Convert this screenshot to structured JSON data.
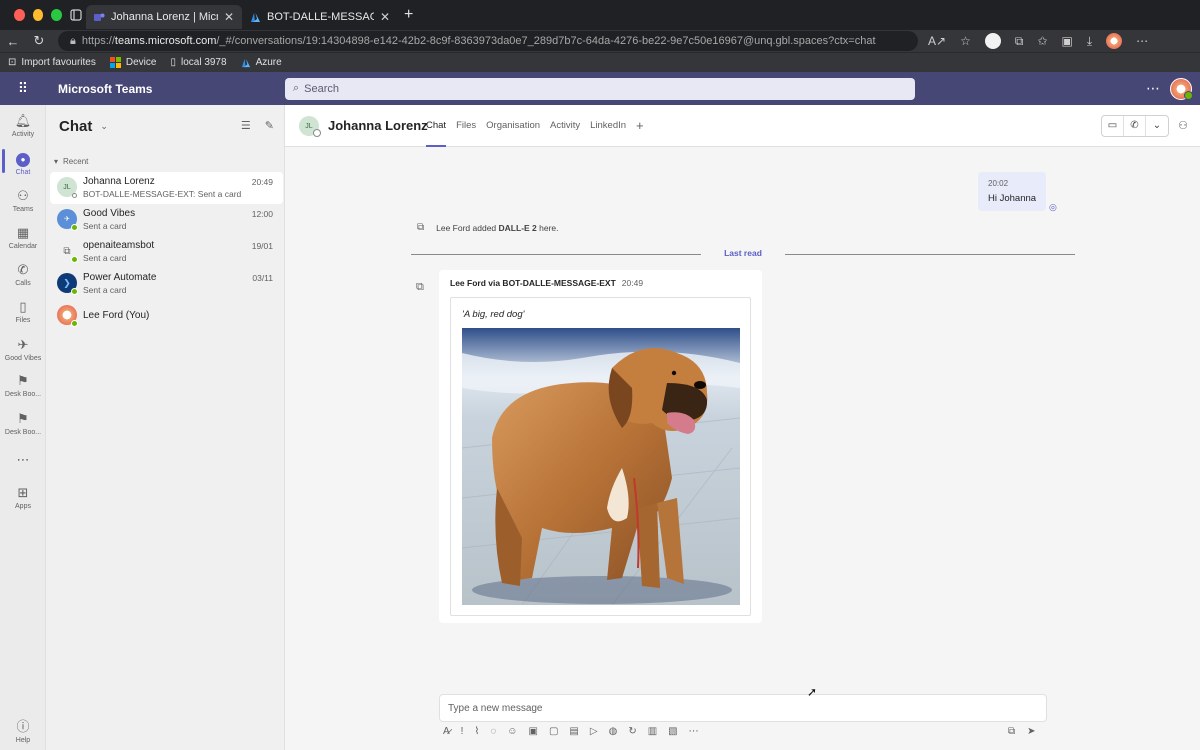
{
  "browser": {
    "tabs": [
      {
        "title": "Johanna Lorenz | Microsoft Teams",
        "active": true
      },
      {
        "title": "BOT-DALLE-MESSAGE-EXT - Mic",
        "active": false
      }
    ],
    "url_prefix": "https://",
    "url_host": "teams.microsoft.com",
    "url_path": "/_#/conversations/19:14304898-e142-42b2-8c9f-8363973da0e7_289d7b7c-64da-4276-be22-9e7c50e16967@unq.gbl.spaces?ctx=chat",
    "bookmarks": [
      "Import favourites",
      "Device",
      "local 3978",
      "Azure"
    ]
  },
  "teams": {
    "app_title": "Microsoft Teams",
    "search_placeholder": "Search",
    "accent": "#5b5fc7",
    "header_bg": "#464775"
  },
  "rail": [
    {
      "label": "Activity",
      "icon": "bell-icon"
    },
    {
      "label": "Chat",
      "icon": "chat-icon",
      "active": true
    },
    {
      "label": "Teams",
      "icon": "teams-icon"
    },
    {
      "label": "Calendar",
      "icon": "calendar-icon"
    },
    {
      "label": "Calls",
      "icon": "phone-icon"
    },
    {
      "label": "Files",
      "icon": "file-icon"
    },
    {
      "label": "Good Vibes",
      "icon": "good-vibes-icon"
    },
    {
      "label": "Desk Boo...",
      "icon": "desk-booking-icon"
    },
    {
      "label": "Desk Boo...",
      "icon": "desk-booking-icon"
    },
    {
      "label": "",
      "icon": "more-icon"
    },
    {
      "label": "Apps",
      "icon": "apps-icon"
    },
    {
      "label": "Help",
      "icon": "help-icon"
    }
  ],
  "chatlist": {
    "heading": "Chat",
    "section": "Recent",
    "items": [
      {
        "name": "Johanna Lorenz",
        "initials": "JL",
        "preview": "BOT-DALLE-MESSAGE-EXT: Sent a card",
        "time": "20:49",
        "selected": true
      },
      {
        "name": "Good Vibes",
        "preview": "Sent a card",
        "time": "12:00"
      },
      {
        "name": "openaiteamsbot",
        "preview": "Sent a card",
        "time": "19/01"
      },
      {
        "name": "Power Automate",
        "preview": "Sent a card",
        "time": "03/11"
      },
      {
        "name": "Lee Ford (You)",
        "preview": "",
        "time": ""
      }
    ]
  },
  "conversation": {
    "name": "Johanna Lorenz",
    "initials": "JL",
    "tabs": [
      "Chat",
      "Files",
      "Organisation",
      "Activity",
      "LinkedIn"
    ],
    "outgoing": {
      "time": "20:02",
      "text": "Hi Johanna"
    },
    "event_prefix": "Lee Ford added ",
    "event_bold": "DALL-E 2",
    "event_suffix": " here.",
    "last_read": "Last read",
    "bot_message": {
      "sender": "Lee Ford via BOT-DALLE-MESSAGE-EXT",
      "time": "20:49",
      "prompt": "'A big, red dog'"
    },
    "composer_placeholder": "Type a new message"
  }
}
